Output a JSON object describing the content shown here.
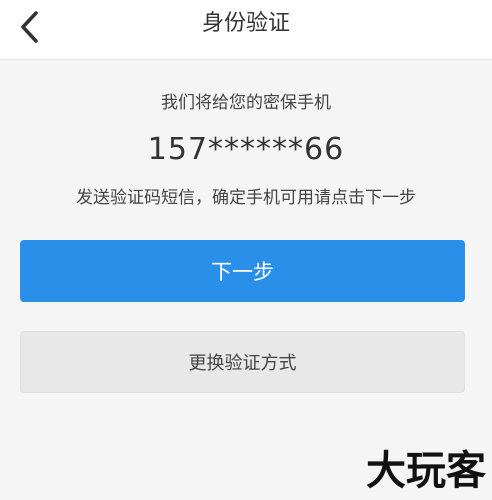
{
  "header": {
    "back_icon": "chevron-left-icon",
    "title": "身份验证"
  },
  "main": {
    "prompt": "我们将给您的密保手机",
    "phone_number": "157******66",
    "description": "发送验证码短信，确定手机可用请点击下一步"
  },
  "actions": {
    "next_label": "下一步",
    "switch_method_label": "更换验证方式"
  },
  "watermark": {
    "text": "大玩客"
  },
  "colors": {
    "primary": "#2a8fe8",
    "background": "#f5f5f5",
    "secondary_button": "#e8e8e8"
  }
}
